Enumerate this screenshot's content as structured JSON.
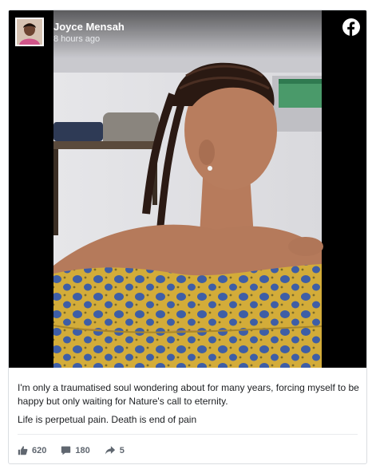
{
  "post": {
    "author": "Joyce Mensah",
    "time": "8 hours ago",
    "paragraphs": [
      "I'm only a traumatised soul wondering about for many years, forcing myself to be happy but only waiting for Nature's call to eternity.",
      "Life is perpetual pain. Death is end of pain"
    ]
  },
  "stats": {
    "likes": "620",
    "comments": "180",
    "shares": "5"
  },
  "icons": {
    "brand": "facebook-icon",
    "like": "thumbs-up-icon",
    "comment": "comment-icon",
    "share": "share-arrow-icon"
  },
  "colors": {
    "facebook_blue": "#ffffff",
    "stat_gray": "#606770",
    "dress_yellow": "#d8b33a",
    "dress_blue": "#3f5fa8"
  }
}
